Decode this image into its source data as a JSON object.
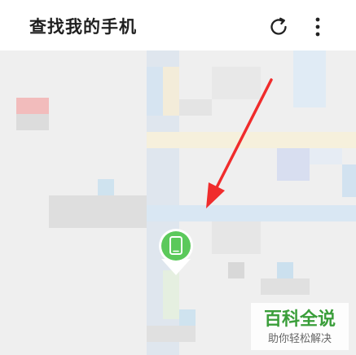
{
  "header": {
    "title": "查找我的手机",
    "refresh_icon": "refresh-icon",
    "more_icon": "more-vertical-icon"
  },
  "map": {
    "device_pin_icon": "phone-icon",
    "arrow_color": "#f02c2c",
    "pin_color": "#5bc95b"
  },
  "watermark": {
    "text": "百科全说",
    "subtext": "助你轻松解决",
    "color": "#3a9e3a"
  }
}
